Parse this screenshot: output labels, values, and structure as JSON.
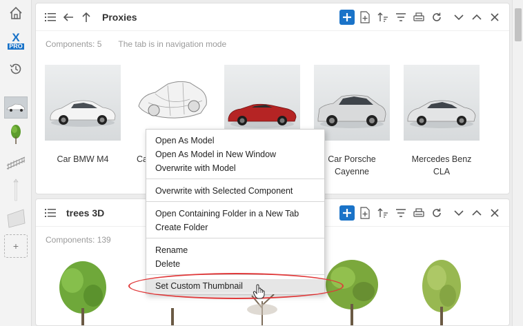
{
  "sidebar": {
    "items": [
      {
        "name": "home-icon"
      },
      {
        "name": "xpro-logo",
        "line1": "X",
        "line2": "PRO"
      },
      {
        "name": "history-icon"
      },
      {
        "name": "proxies-thumbnail"
      },
      {
        "name": "tree-thumbnail"
      },
      {
        "name": "fence-thumbnail"
      },
      {
        "name": "pole-thumbnail"
      },
      {
        "name": "panel-thumbnail"
      },
      {
        "name": "add-library-button",
        "label": "+"
      }
    ]
  },
  "panels": [
    {
      "title": "Proxies",
      "components": "Components: 5",
      "mode": "The tab is in navigation mode",
      "items": [
        {
          "label": "Car BMW M4"
        },
        {
          "label": "Ca"
        },
        {
          "label": ""
        },
        {
          "label": "Car Porsche Cayenne"
        },
        {
          "label": "Mercedes Benz CLA"
        }
      ]
    },
    {
      "title": "trees 3D",
      "components": "Components: 139"
    }
  ],
  "context_menu": {
    "groups": [
      [
        "Open As Model",
        "Open As Model in New Window",
        "Overwrite with Model"
      ],
      [
        "Overwrite with Selected Component"
      ],
      [
        "Open Containing Folder in a New Tab",
        "Create Folder"
      ],
      [
        "Rename",
        "Delete"
      ],
      [
        "Set Custom Thumbnail"
      ]
    ],
    "highlighted": "Set Custom Thumbnail"
  },
  "colors": {
    "accent": "#1a73c8",
    "annotation": "#e0393a",
    "car_red": "#b52424"
  }
}
